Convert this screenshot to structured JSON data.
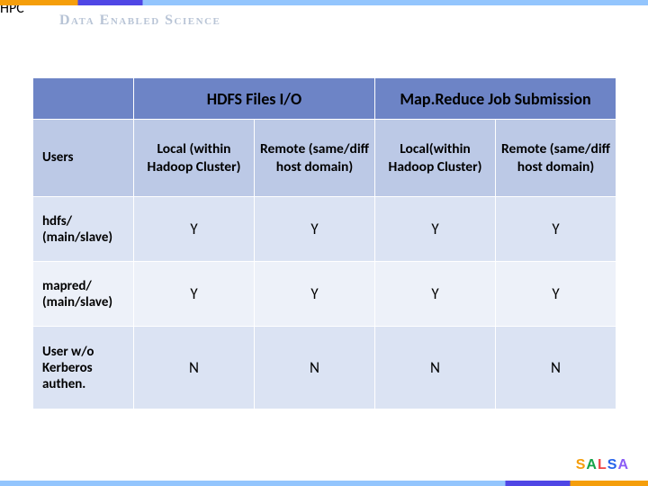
{
  "brand": "Data Enabled Science",
  "table": {
    "topHeaders": [
      "HDFS Files I/O",
      "Map.Reduce Job Submission"
    ],
    "cornerLabel": "Users",
    "subHeaders": [
      "Local (within Hadoop Cluster)",
      "Remote (same/diff host domain)",
      "Local(within Hadoop Cluster)",
      "Remote (same/diff host domain)"
    ],
    "rows": [
      {
        "label": "hdfs/ (main/slave)",
        "values": [
          "Y",
          "Y",
          "Y",
          "Y"
        ]
      },
      {
        "label": "mapred/ (main/slave)",
        "values": [
          "Y",
          "Y",
          "Y",
          "Y"
        ]
      },
      {
        "label": "User w/o Kerberos authen.",
        "values": [
          "N",
          "N",
          "N",
          "N"
        ]
      }
    ]
  },
  "logo": {
    "letters": [
      "S",
      "A",
      "L",
      "S",
      "A"
    ],
    "suffix": "HPC"
  }
}
